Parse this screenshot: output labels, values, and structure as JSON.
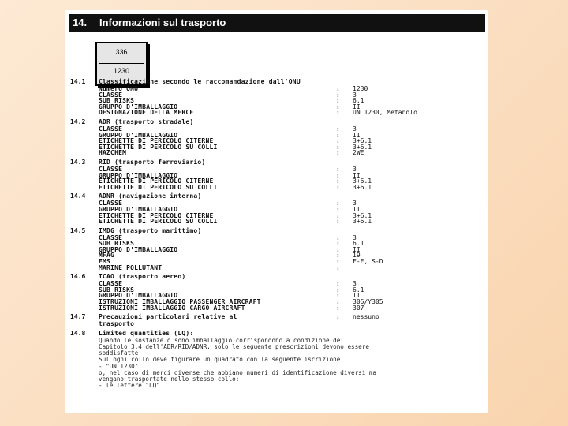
{
  "header": {
    "number": "14.",
    "title": "Informazioni sul trasporto"
  },
  "plate": {
    "top": "336",
    "bottom": "1230"
  },
  "sections": [
    {
      "num": "14.1",
      "title": "Classificazione secondo le raccomandazione dall'ONU",
      "rows": [
        {
          "label": "Numero ONU",
          "value": "1230"
        },
        {
          "label": "CLASSE",
          "value": "3"
        },
        {
          "label": "SUB RISKS",
          "value": "6.1"
        },
        {
          "label": "GRUPPO D'IMBALLAGGIO",
          "value": "II"
        },
        {
          "label": "DESIGNAZIONE DELLA MERCE",
          "value": "UN 1230, Metanolo"
        }
      ]
    },
    {
      "num": "14.2",
      "title": "ADR (trasporto stradale)",
      "rows": [
        {
          "label": "CLASSE",
          "value": "3"
        },
        {
          "label": "GRUPPO D'IMBALLAGGIO",
          "value": "II"
        },
        {
          "label": "ETICHETTE DI PERICOLO CITERNE",
          "value": "3+6.1"
        },
        {
          "label": "ETICHETTE DI PERICOLO SU COLLI",
          "value": "3+6.1"
        },
        {
          "label": "HAZCHEM",
          "value": "2WE"
        }
      ]
    },
    {
      "num": "14.3",
      "title": "RID (trasporto ferroviario)",
      "rows": [
        {
          "label": "CLASSE",
          "value": "3"
        },
        {
          "label": "GRUPPO D'IMBALLAGGIO",
          "value": "II"
        },
        {
          "label": "ETICHETTE DI PERICOLO CITERNE",
          "value": "3+6.1"
        },
        {
          "label": "ETICHETTE DI PERICOLO SU COLLI",
          "value": "3+6.1"
        }
      ]
    },
    {
      "num": "14.4",
      "title": "ADNR (navigazione interna)",
      "rows": [
        {
          "label": "CLASSE",
          "value": "3"
        },
        {
          "label": "GRUPPO D'IMBALLAGGIO",
          "value": "II"
        },
        {
          "label": "ETICHETTE DI PERICOLO CITERNE",
          "value": "3+6.1"
        },
        {
          "label": "ETICHETTE DI PERICOLO SU COLLI",
          "value": "3+6.1"
        }
      ]
    },
    {
      "num": "14.5",
      "title": "IMDG (trasporto marittimo)",
      "rows": [
        {
          "label": "CLASSE",
          "value": "3"
        },
        {
          "label": "SUB RISKS",
          "value": "6.1"
        },
        {
          "label": "GRUPPO D'IMBALLAGGIO",
          "value": "II"
        },
        {
          "label": "MFAG",
          "value": "19"
        },
        {
          "label": "EMS",
          "value": "F-E, S-D"
        },
        {
          "label": "MARINE POLLUTANT",
          "value": ""
        }
      ]
    },
    {
      "num": "14.6",
      "title": "ICAO (trasporto aereo)",
      "rows": [
        {
          "label": "CLASSE",
          "value": "3"
        },
        {
          "label": "SUB RISKS",
          "value": "6.1"
        },
        {
          "label": "GRUPPO D'IMBALLAGGIO",
          "value": "II"
        },
        {
          "label": "ISTRUZIONI IMBALLAGGIO PASSENGER AIRCRAFT",
          "value": "305/Y305"
        },
        {
          "label": "ISTRUZIONI IMBALLAGGIO CARGO AIRCRAFT",
          "value": "307"
        }
      ]
    },
    {
      "num": "14.7",
      "title": "Precauzioni particolari relative al",
      "title2": "trasporto",
      "value": "nessuno",
      "rows": []
    },
    {
      "num": "14.8",
      "title": "Limited quantities (LQ):",
      "notes": [
        "Quando le sostanze o sono imballaggio corrispondono a  condizione del",
        "Capitolo 3.4 dell'ADR/RID/ADNR, solo le seguente prescrizioni devono essere",
        "soddisfatte:",
        "Sul ogni collo deve figurare un quadrato con la seguente iscrizione:",
        "- \"UN 1230\"",
        "o, nel caso di merci diverse che abbiano numeri di identificazione diversi ma",
        "vengano trasportate nello stesso collo:",
        "- le lettere \"LQ\""
      ]
    }
  ]
}
